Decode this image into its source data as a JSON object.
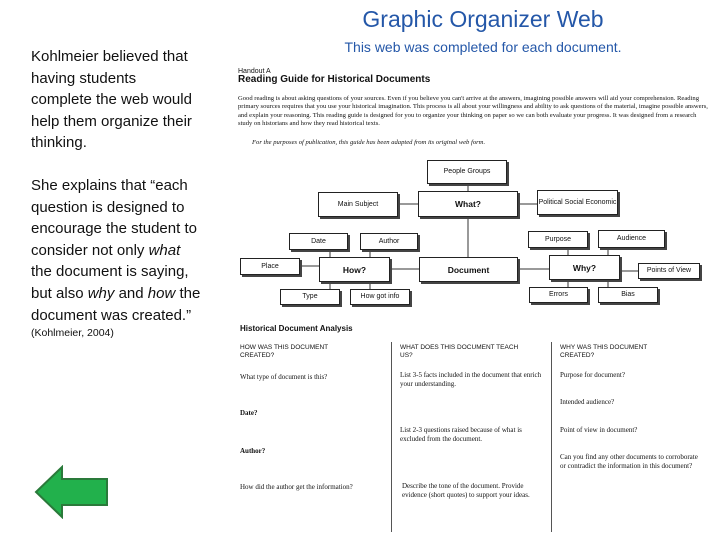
{
  "slide": {
    "title": "Graphic Organizer Web",
    "subtitle": "This web was completed for each document.",
    "paragraph1": "Kohlmeier believed that having students complete the web would help them organize their thinking.",
    "p2_a": "She explains that “each question is designed to encourage the student to consider not only ",
    "p2_what": "what",
    "p2_b": " the document is saying, but also ",
    "p2_why": "why",
    "p2_c": " and ",
    "p2_how": "how",
    "p2_d": " the document was created.”",
    "citation": "(Kohlmeier, 2004)",
    "arrow_color": "#22b14c"
  },
  "handout": {
    "label": "Handout A",
    "title": "Reading Guide for Historical Documents",
    "intro": "Good reading is about asking questions of your sources. Even if you believe you can't arrive at the answers, imagining possible answers will aid your comprehension. Reading primary sources requires that you use your historical imagination. This process is all about your willingness and ability to ask questions of the material, imagine possible answers, and explain your reasoning. This reading guide is designed for you to organize your thinking on paper so we can both evaluate your progress. It was designed from a research study on historians and how they read historical texts.",
    "note": "For the purposes of publication, this guide has been adapted from its original web form.",
    "web": {
      "people": "People Groups",
      "main_subject": "Main Subject",
      "what": "What?",
      "political": "Political Social Economic",
      "date": "Date",
      "author": "Author",
      "place": "Place",
      "how": "How?",
      "document": "Document",
      "why": "Why?",
      "purpose": "Purpose",
      "audience": "Audience",
      "points_of_view": "Points of View",
      "type": "Type",
      "how_got_info": "How got info",
      "errors": "Errors",
      "bias": "Bias"
    },
    "analysis": {
      "title": "Historical Document Analysis",
      "col1": {
        "header": "HOW WAS THIS DOCUMENT CREATED?",
        "q1": "What type of document is this?",
        "q2": "Date?",
        "q3": "Author?",
        "q4": "How did the author get the information?"
      },
      "col2": {
        "header": "WHAT DOES THIS DOCUMENT TEACH US?",
        "q1": "List 3-5 facts included in the document that enrich your understanding.",
        "q2": "List 2-3 questions raised because of what is excluded from the document.",
        "q3": "Describe the tone of the document. Provide evidence (short quotes) to support your ideas."
      },
      "col3": {
        "header": "WHY WAS THIS DOCUMENT CREATED?",
        "q1": "Purpose for document?",
        "q2": "Intended audience?",
        "q3": "Point of view in document?",
        "q4": "Can you find any other documents to corroborate or contradict the information in this document?"
      }
    }
  }
}
